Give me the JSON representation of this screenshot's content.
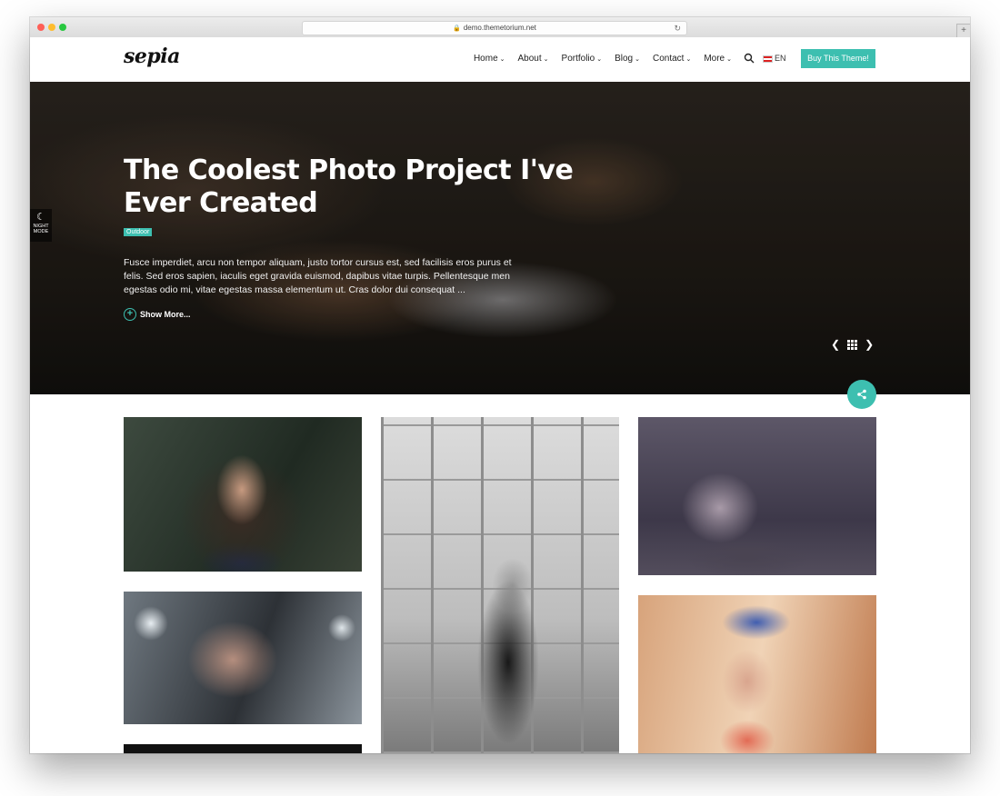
{
  "browser": {
    "url": "demo.themetorium.net"
  },
  "site": {
    "logo": "sepia",
    "nav": [
      {
        "label": "Home"
      },
      {
        "label": "About"
      },
      {
        "label": "Portfolio"
      },
      {
        "label": "Blog"
      },
      {
        "label": "Contact"
      },
      {
        "label": "More"
      }
    ],
    "lang": "EN",
    "buy_label": "Buy This Theme!"
  },
  "night_mode": {
    "line1": "NIGHT",
    "line2": "MODE"
  },
  "hero": {
    "title": "The Coolest Photo Project I've Ever Created",
    "tag": "Outdoor",
    "text": "Fusce imperdiet, arcu non tempor aliquam, justo tortor cursus est, sed facilisis eros purus et felis. Sed eros sapien, iaculis eget gravida euismod, dapibus vitae turpis. Pellentesque men egestas odio mi, vitae egestas massa elementum ut. Cras dolor dui consequat ...",
    "show_more": "Show More..."
  },
  "colors": {
    "accent": "#3dbfb0"
  },
  "icons": {
    "search": "search-icon",
    "share": "share-icon",
    "prev": "chevron-left-icon",
    "next": "chevron-right-icon",
    "grid": "grid-icon",
    "moon": "moon-icon"
  }
}
